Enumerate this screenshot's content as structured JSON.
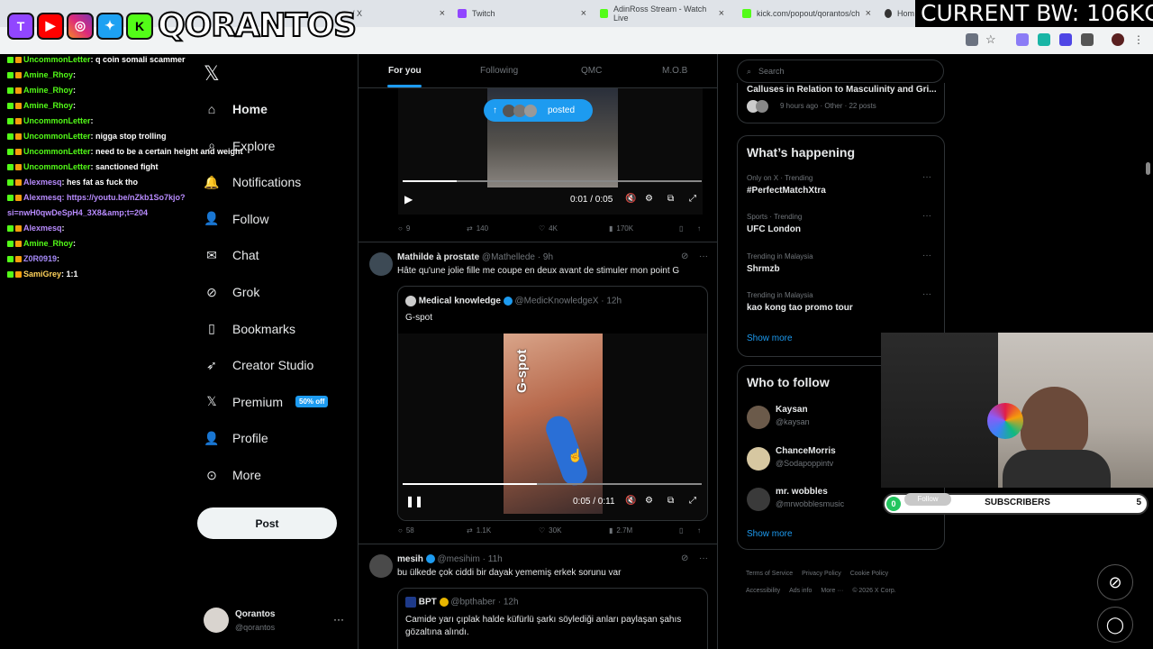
{
  "browser": {
    "tabs": [
      {
        "label": "me / X"
      },
      {
        "label": "Twitch"
      },
      {
        "label": "AdinRoss Stream - Watch Live"
      },
      {
        "label": "kick.com/popout/qorantos/ch"
      },
      {
        "label": "Hom"
      }
    ]
  },
  "overlay": {
    "name": "QORANTOS",
    "bandwidth": "CURRENT BW: 106KG",
    "subscribers_label": "SUBSCRIBERS",
    "subscribers_left": "0",
    "subscribers_right": "5",
    "follow_label": "Follow"
  },
  "chat": [
    {
      "user": "UncommonLetter",
      "msg": ": q coin somali scammer",
      "color": "#53fc18"
    },
    {
      "user": "Amine_Rhoy",
      "msg": ":",
      "color": "#53fc18"
    },
    {
      "user": "Amine_Rhoy",
      "msg": ":",
      "color": "#53fc18"
    },
    {
      "user": "Amine_Rhoy",
      "msg": ":",
      "color": "#53fc18"
    },
    {
      "user": "UncommonLetter",
      "msg": ":",
      "color": "#53fc18"
    },
    {
      "user": "UncommonLetter",
      "msg": ": nigga stop trolling",
      "color": "#53fc18"
    },
    {
      "user": "UncommonLetter",
      "msg": ": need to be a certain height and weight",
      "color": "#53fc18"
    },
    {
      "user": "UncommonLetter",
      "msg": ": sanctioned fight",
      "color": "#53fc18"
    },
    {
      "user": "Alexmesq",
      "msg": ": hes fat as fuck tho",
      "color": "#b98cff"
    },
    {
      "user": "Alexmesq",
      "msg": ": https://youtu.be/nZkb1So7kjo?",
      "color": "#b98cff"
    },
    {
      "user": "",
      "msg": "si=nwH0qwDeSpH4_3X8&amp;t=204",
      "color": "#b98cff"
    },
    {
      "user": "Alexmesq",
      "msg": ":",
      "color": "#b98cff"
    },
    {
      "user": "Amine_Rhoy",
      "msg": ":",
      "color": "#53fc18"
    },
    {
      "user": "Z0R0919",
      "msg": ":",
      "color": "#a78bfa"
    },
    {
      "user": "SamiGrey",
      "msg": ": 1:1",
      "color": "#ffd35c"
    }
  ],
  "nav": {
    "items": [
      {
        "label": "Home",
        "icon": "home-icon"
      },
      {
        "label": "Explore",
        "icon": "search-icon"
      },
      {
        "label": "Notifications",
        "icon": "bell-icon"
      },
      {
        "label": "Follow",
        "icon": "add-person-icon"
      },
      {
        "label": "Chat",
        "icon": "mail-icon"
      },
      {
        "label": "Grok",
        "icon": "grok-icon"
      },
      {
        "label": "Bookmarks",
        "icon": "bookmark-icon"
      },
      {
        "label": "Creator Studio",
        "icon": "rocket-icon"
      },
      {
        "label": "Premium",
        "icon": "x-icon"
      },
      {
        "label": "Profile",
        "icon": "person-icon"
      },
      {
        "label": "More",
        "icon": "more-circle-icon"
      }
    ],
    "premium_badge": "50% off",
    "post_label": "Post",
    "account_name": "Qorantos",
    "account_handle": "@qorantos"
  },
  "feed": {
    "tabs": [
      "For you",
      "Following",
      "QMC",
      "M.O.B"
    ],
    "posted_pill": "posted",
    "tweet1": {
      "time": "0:01 / 0:05",
      "progress": 0.18,
      "replies": "9",
      "reposts": "140",
      "likes": "4K",
      "views": "170K"
    },
    "tweet2": {
      "name": "Mathilde à prostate",
      "handle": "@Mathellede",
      "age": "· 9h",
      "text": "Hâte qu'une jolie fille me coupe en deux avant de stimuler mon point G",
      "quote_name": "Medical knowledge",
      "quote_handle": "@MedicKnowledgeX",
      "quote_age": "· 12h",
      "quote_text": "G-spot",
      "video_label": "G-spot",
      "time": "0:05 / 0:11",
      "progress": 0.45,
      "replies": "58",
      "reposts": "1.1K",
      "likes": "30K",
      "views": "2.7M"
    },
    "tweet3": {
      "name": "mesih",
      "handle": "@mesihim",
      "age": "· 11h",
      "text": "bu ülkede çok ciddi bir dayak yememiş erkek sorunu var",
      "quote_name": "BPT",
      "quote_handle": "@bpthaber",
      "quote_age": "· 12h",
      "quote_text": "Camide yarı çıplak halde küfürlü şarkı söylediği anları paylaşan şahıs gözaltına alındı."
    }
  },
  "right": {
    "search_placeholder": "Search",
    "top_card_title": "Calluses in Relation to Masculinity and Gri...",
    "top_card_meta": "9 hours ago · Other · 22 posts",
    "happening_title": "What’s happening",
    "trends": [
      {
        "meta": "Only on X · Trending",
        "name": "#PerfectMatchXtra"
      },
      {
        "meta": "Sports · Trending",
        "name": "UFC London"
      },
      {
        "meta": "Trending in Malaysia",
        "name": "Shrmzb"
      },
      {
        "meta": "Trending in Malaysia",
        "name": "kao kong tao promo tour"
      }
    ],
    "show_more": "Show more",
    "who_title": "Who to follow",
    "who": [
      {
        "name": "Kaysan",
        "handle": "@kaysan"
      },
      {
        "name": "ChanceMorris",
        "handle": "@Sodapoppintv"
      },
      {
        "name": "mr. wobbles",
        "handle": "@mrwobblesmusic"
      }
    ],
    "footer": [
      "Terms of Service",
      "Privacy Policy",
      "Cookie Policy",
      "Accessibility",
      "Ads info",
      "More ···",
      "© 2026 X Corp."
    ]
  }
}
